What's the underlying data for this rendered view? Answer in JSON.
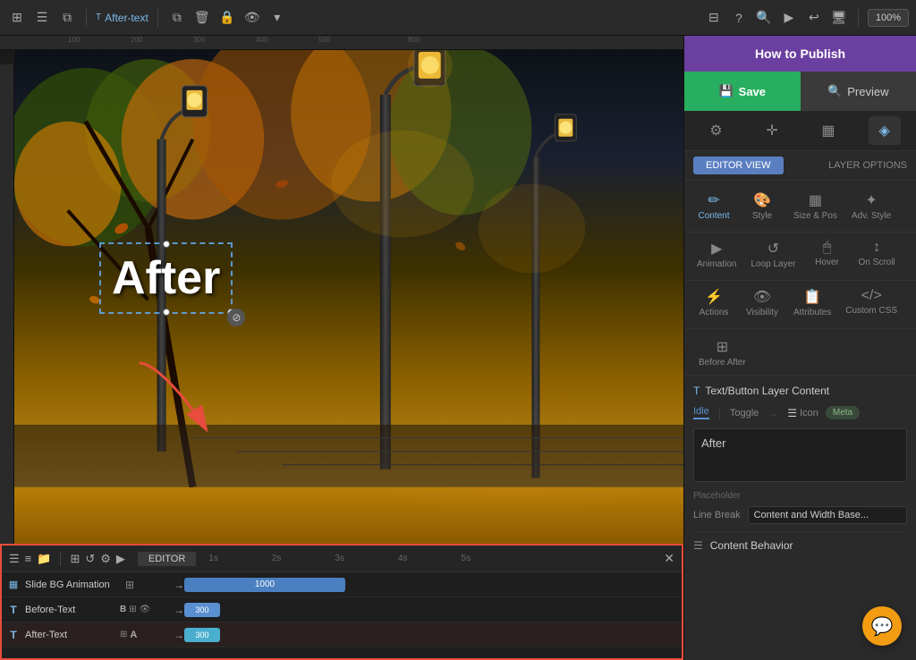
{
  "app": {
    "title": "How to Publish",
    "layer_name": "After-text"
  },
  "toolbar": {
    "zoom": "100%",
    "save_label": "Save",
    "preview_label": "Preview"
  },
  "tabs": {
    "content_label": "Content",
    "style_label": "Style",
    "size_pos_label": "Size & Pos",
    "adv_style_label": "Adv. Style",
    "animation_label": "Animation",
    "loop_layer_label": "Loop Layer",
    "hover_label": "Hover",
    "on_scroll_label": "On Scroll",
    "actions_label": "Actions",
    "visibility_label": "Visibility",
    "attributes_label": "Attributes",
    "custom_css_label": "Custom CSS",
    "before_after_label": "Before After"
  },
  "view_toggle": {
    "editor_view": "EDITOR VIEW",
    "layer_options": "LAYER OPTIONS"
  },
  "content_panel": {
    "section_title": "Text/Button Layer Content",
    "idle_label": "Idle",
    "toggle_label": "Toggle",
    "icon_label": "Icon",
    "meta_label": "Meta",
    "text_content": "After",
    "placeholder_label": "Placeholder",
    "line_break_label": "Line Break",
    "line_break_value": "Content and Width Base...",
    "content_behavior_label": "Content Behavior"
  },
  "timeline": {
    "editor_label": "EDITOR",
    "close_label": "×",
    "time_marks": [
      "1s",
      "2s",
      "3s",
      "4s",
      "5s"
    ],
    "rows": [
      {
        "id": "slide-bg",
        "icon": "▦",
        "label": "Slide BG Animation",
        "track_value": "1000",
        "track_type": "blue"
      },
      {
        "id": "before-text",
        "icon": "T",
        "label": "Before-Text",
        "track_value": "300",
        "track_type": "small-blue",
        "controls": "B⊞ 👁 →"
      },
      {
        "id": "after-text",
        "icon": "T",
        "label": "After-Text",
        "track_value": "300",
        "track_type": "teal",
        "controls": "⊞A →"
      }
    ]
  },
  "canvas": {
    "after_text": "After"
  }
}
